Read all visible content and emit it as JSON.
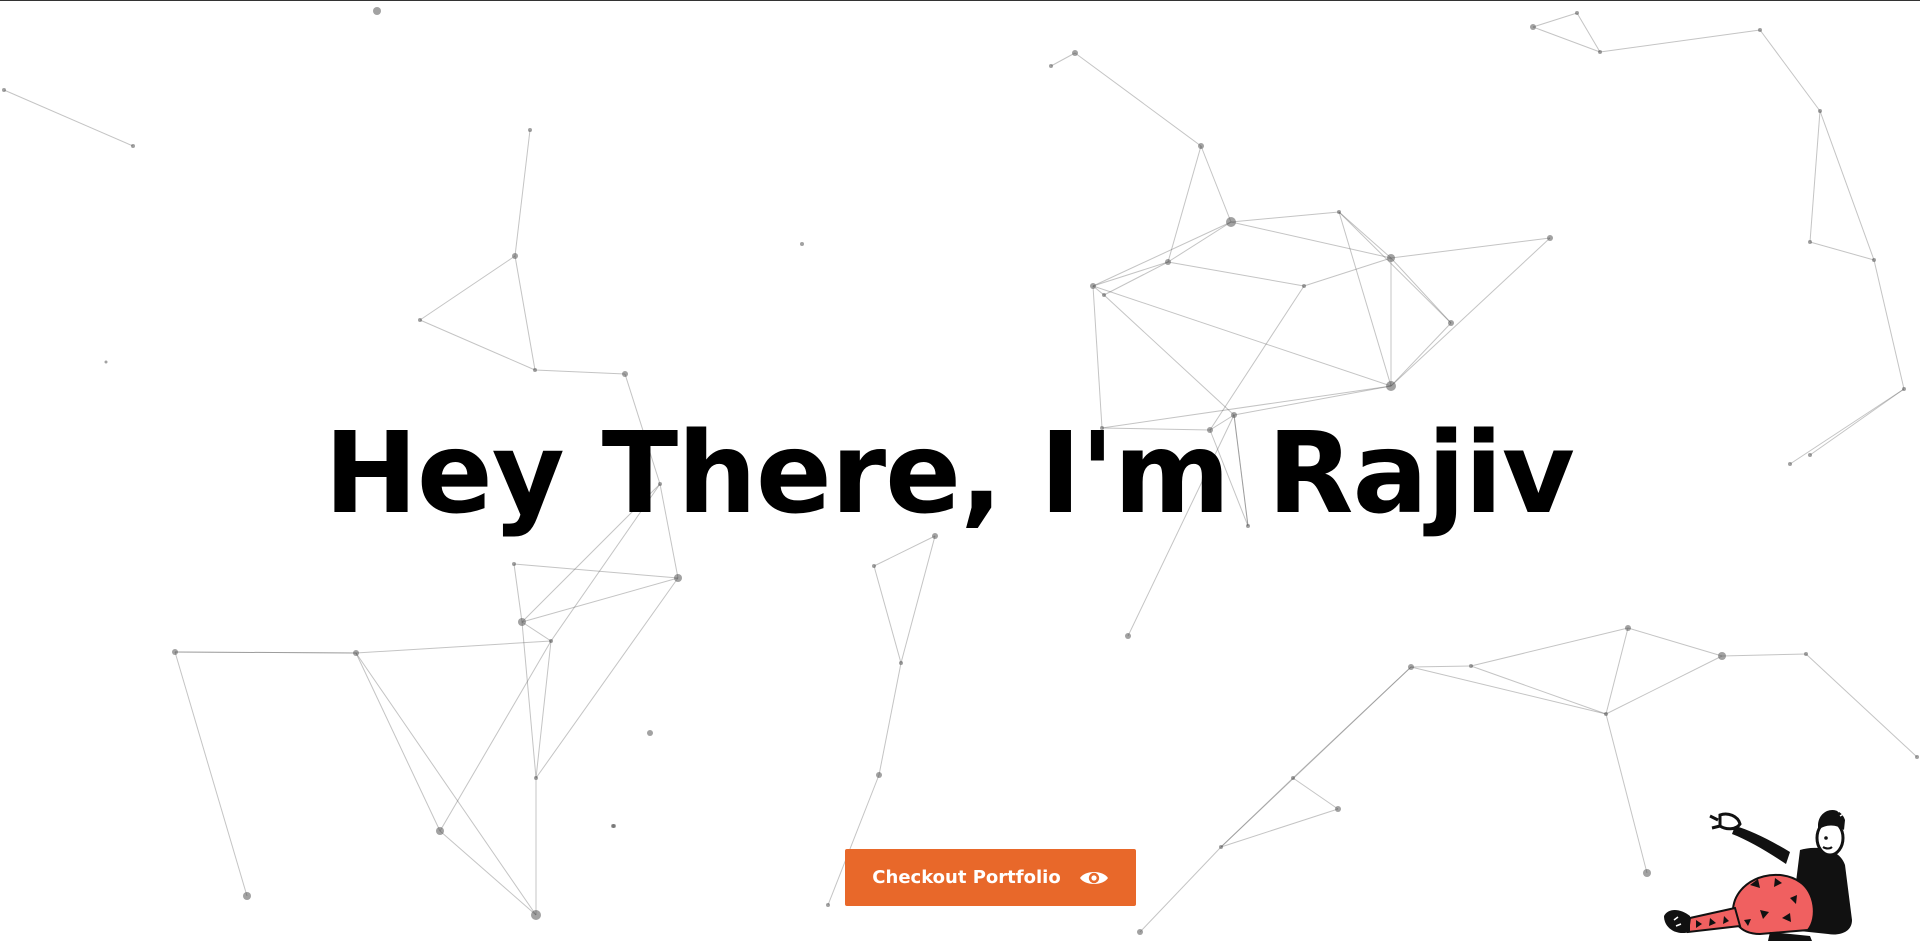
{
  "hero": {
    "title": "Hey There, I'm Rajiv"
  },
  "cta": {
    "label": "Checkout Portfolio",
    "icon": "eye-icon",
    "background": "#e8682a",
    "text_color": "#ffffff"
  },
  "illustration": {
    "name": "reclining-person-illustration",
    "accent": "#f06060"
  },
  "colors": {
    "background": "#ffffff",
    "text": "#000000",
    "network": "#555555"
  }
}
